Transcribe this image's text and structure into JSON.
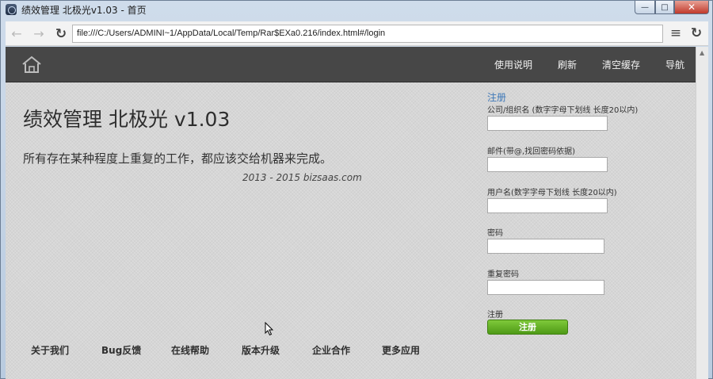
{
  "window": {
    "title": "绩效管理 北极光v1.03 - 首页",
    "controls": {
      "minimize": "—",
      "maximize": "□",
      "close": "✕"
    }
  },
  "browser": {
    "url": "file:///C:/Users/ADMINI~1/AppData/Local/Temp/Rar$EXa0.216/index.html#/login",
    "back_glyph": "←",
    "forward_glyph": "→",
    "reload_glyph": "↻",
    "menu_glyph": "≡",
    "refresh_glyph": "↻"
  },
  "site": {
    "nav": {
      "items": [
        {
          "label": "使用说明"
        },
        {
          "label": "刷新"
        },
        {
          "label": "清空缓存"
        },
        {
          "label": "导航"
        }
      ]
    },
    "hero": {
      "title": "绩效管理 北极光 v1.03",
      "subtitle": "所有存在某种程度上重复的工作，都应该交给机器来完成。",
      "copyright": "2013 - 2015 bizsaas.com"
    },
    "register": {
      "title": "注册",
      "fields": [
        {
          "label": "公司/组织名 (数字字母下划线 长度20以内)",
          "value": ""
        },
        {
          "label": "邮件(带@,找回密码依据)",
          "value": ""
        },
        {
          "label": "用户名(数字字母下划线 长度20以内)",
          "value": ""
        },
        {
          "label": "密码",
          "value": ""
        },
        {
          "label": "重复密码",
          "value": ""
        }
      ],
      "submit_caption": "注册",
      "submit_button": "注册"
    },
    "footer": {
      "links": [
        {
          "label": "关于我们"
        },
        {
          "label": "Bug反馈"
        },
        {
          "label": "在线帮助"
        },
        {
          "label": "版本升级"
        },
        {
          "label": "企业合作"
        },
        {
          "label": "更多应用"
        }
      ]
    }
  },
  "colors": {
    "header_bg": "#474747",
    "accent_link": "#3e78b8",
    "submit_green": "#5fae22"
  }
}
